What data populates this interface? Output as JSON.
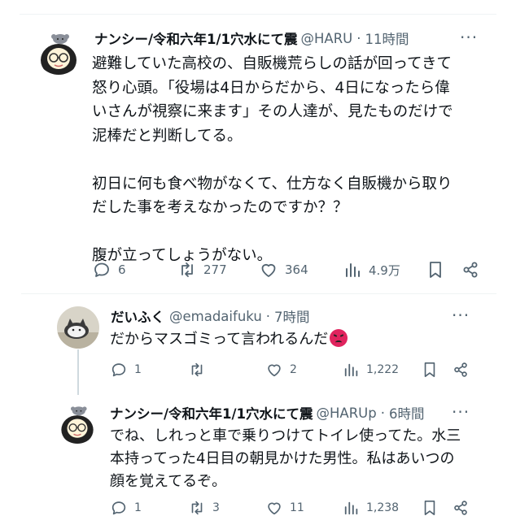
{
  "tweets": [
    {
      "name": "ナンシー/令和六年1/1穴水にて震",
      "handle": "@HARU",
      "time": "11時間",
      "body": [
        "避難していた高校の、自販機荒らしの話が回ってきて",
        "怒り心頭。「役場は4日からだから、4日になったら偉",
        "いさんが視察に来ます」その人達が、見たものだけで",
        "泥棒だと判断してる。",
        "",
        "初日に何も食べ物がなくて、仕方なく自販機から取り",
        "だした事を考えなかったのですか？？",
        "",
        "腹が立ってしょうがない。"
      ],
      "replies": "6",
      "retweets": "277",
      "likes": "364",
      "views": "4.9万"
    },
    {
      "name": "だいふく",
      "handle": "@emadaifuku",
      "time": "7時間",
      "body": [
        "だからマスゴミって言われるんだ"
      ],
      "emoji": "angry-face-emoji",
      "replies": "1",
      "retweets": "",
      "likes": "2",
      "views": "1,222"
    },
    {
      "name": "ナンシー/令和六年1/1穴水にて震",
      "handle": "@HARUp",
      "time": "6時間",
      "body": [
        "でね、しれっと車で乗りつけてトイレ使ってた。水三",
        "本持ってった4日目の朝見かけた男性。私はあいつの",
        "顔を覚えてるぞ。"
      ],
      "replies": "1",
      "retweets": "3",
      "likes": "11",
      "views": "1,238"
    }
  ],
  "more_glyph": "···",
  "dot": "·"
}
